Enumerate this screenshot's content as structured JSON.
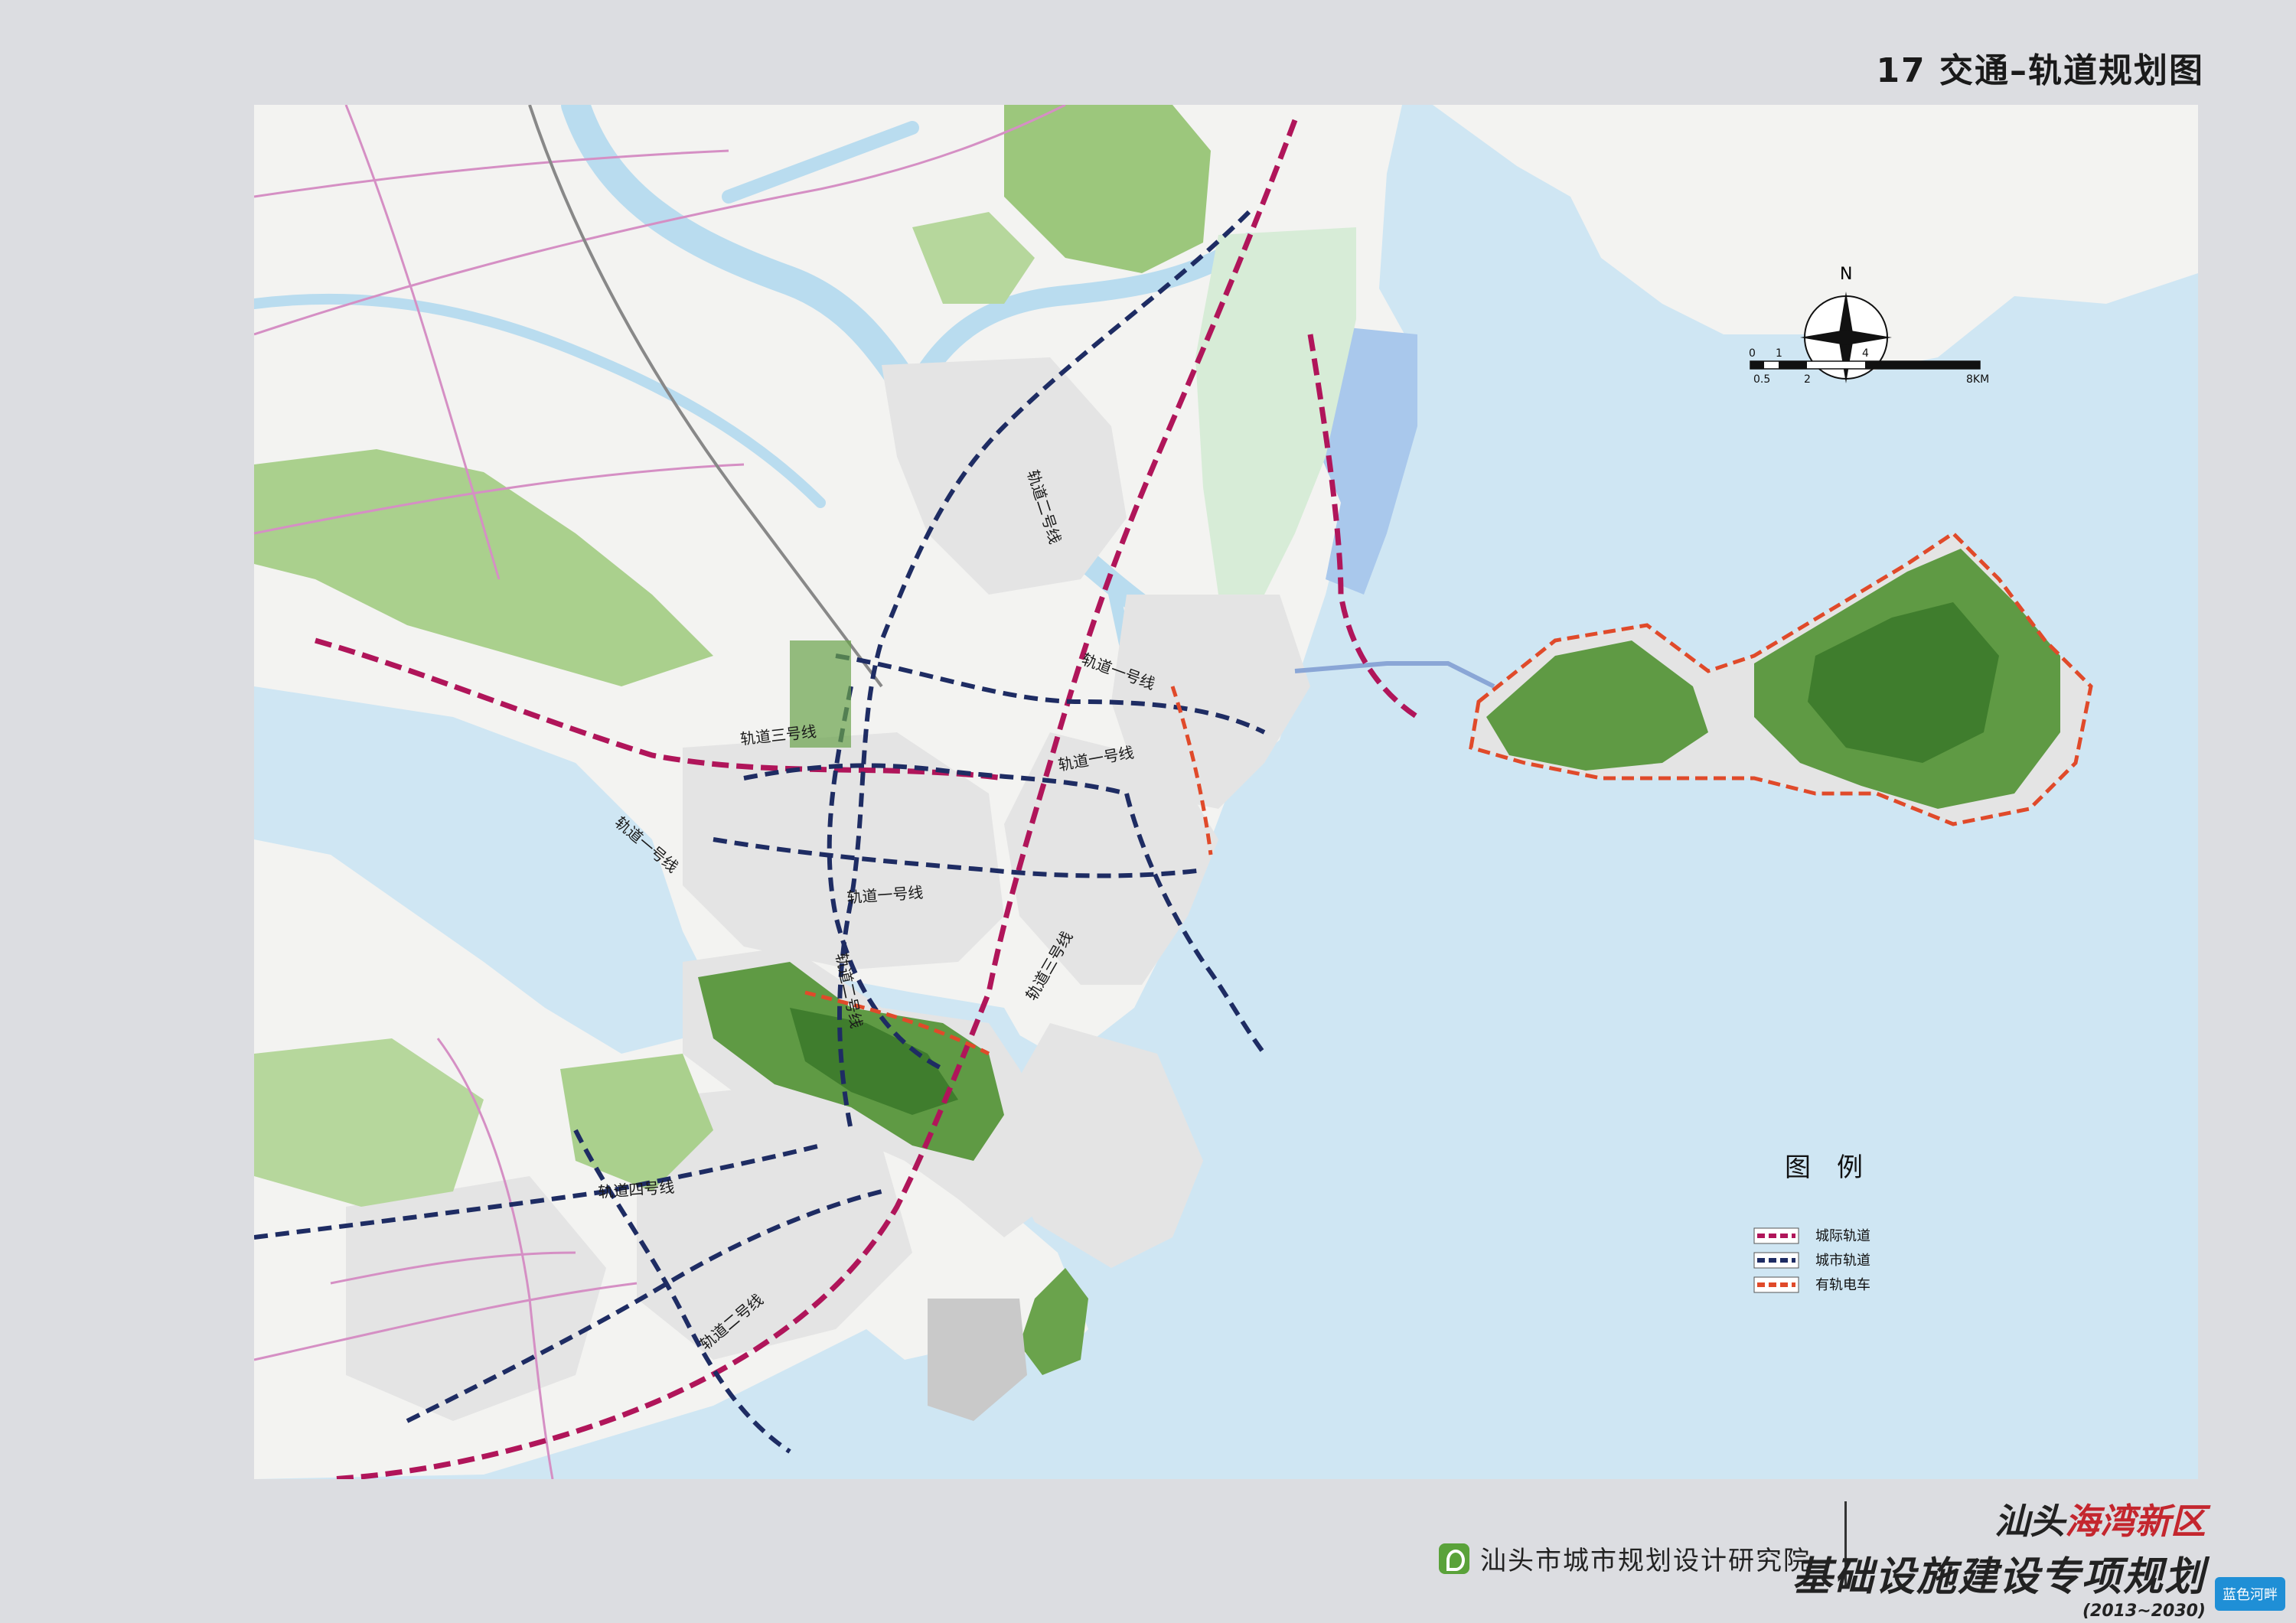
{
  "sheet": {
    "number": "17",
    "title": "交通–轨道规划图"
  },
  "map": {
    "colors": {
      "sea": "#cfe6f3",
      "land": "#f3f3f1",
      "river": "#b9dcef",
      "forest": "#8fbf6c",
      "forest_dark": "#4f8f3a",
      "urban": "#e4e4e4",
      "intercity": "#b0155a",
      "urban_rail": "#1e2c63",
      "tram": "#e04a2a",
      "highway": "#d58fc4",
      "railway": "#888888"
    },
    "line_labels": [
      {
        "id": "l2-north",
        "text": "轨道二号线"
      },
      {
        "id": "l1-center",
        "text": "轨道一号线"
      },
      {
        "id": "l3-west",
        "text": "轨道三号线"
      },
      {
        "id": "l1-east",
        "text": "轨道一号线"
      },
      {
        "id": "l1-west",
        "text": "轨道一号线"
      },
      {
        "id": "l1-mid",
        "text": "轨道一号线"
      },
      {
        "id": "l2-south",
        "text": "轨道二号线"
      },
      {
        "id": "l3-south",
        "text": "轨道三号线"
      },
      {
        "id": "l4",
        "text": "轨道四号线"
      },
      {
        "id": "l2-sw",
        "text": "轨道二号线"
      }
    ]
  },
  "compass": {
    "label": "N"
  },
  "scale_bar": {
    "top_labels": [
      "0",
      "1",
      "4"
    ],
    "bottom_labels": [
      "0.5",
      "2",
      "8KM"
    ]
  },
  "legend": {
    "title": "图　例",
    "items": [
      {
        "label": "城际轨道",
        "color": "#b0155a"
      },
      {
        "label": "城市轨道",
        "color": "#1e2c63"
      },
      {
        "label": "有轨电车",
        "color": "#e04a2a"
      }
    ]
  },
  "footer": {
    "institute": "汕头市城市规划设计研究院",
    "project_prefix": "汕头",
    "project_highlight": "海湾新区",
    "project_title": "基础设施建设专项规划",
    "years": "(2013~2030)"
  },
  "watermark": {
    "text": "蓝色河畔"
  }
}
